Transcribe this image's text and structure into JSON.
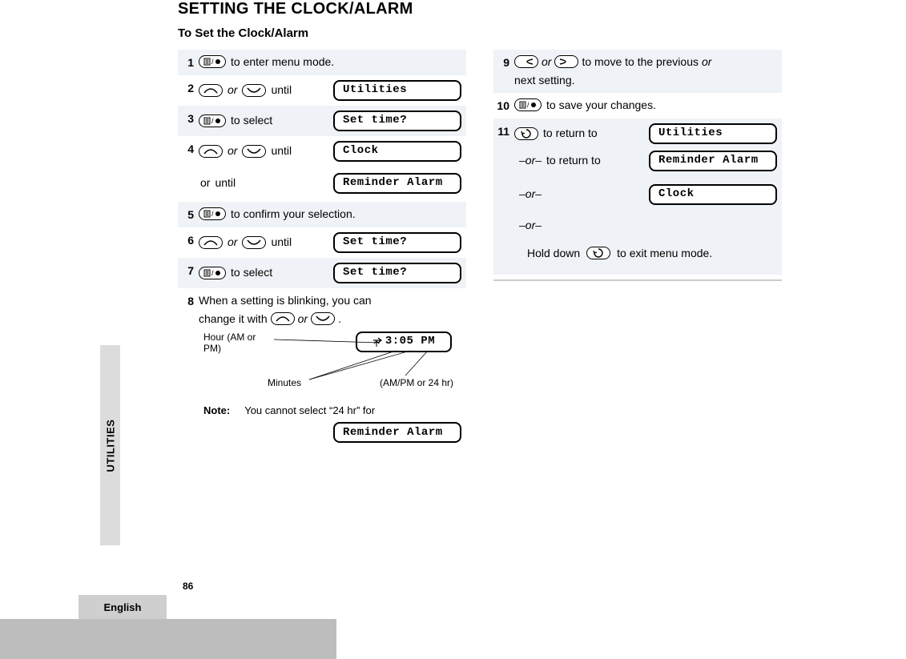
{
  "meta": {
    "side_tab": "UTILITIES",
    "language": "English",
    "page_number": "86"
  },
  "title": "SETTING THE CLOCK/ALARM",
  "subtitle": "To Set the Clock/Alarm",
  "left_steps": {
    "s1": {
      "num": "1",
      "t1": " to enter menu mode."
    },
    "s2": {
      "num": "2",
      "or": "or",
      "t1": " until",
      "lcd": "Utilities"
    },
    "s3": {
      "num": "3",
      "t1": " to select",
      "lcd": "Set time?"
    },
    "s4": {
      "num": "4",
      "or": "or",
      "t1": " until",
      "lcd": "Clock",
      "sub_or": "or",
      "sub_t1": " until",
      "sub_lcd": "Reminder Alarm"
    },
    "s5": {
      "num": "5",
      "t1": " to confirm your selection."
    },
    "s6": {
      "num": "6",
      "or": "or",
      "t1": " until",
      "lcd": "Set time?"
    },
    "s7": {
      "num": "7",
      "t1": " to select",
      "lcd": "Set time?"
    },
    "s8": {
      "num": "8",
      "line1a": "When a setting is blinking, you can",
      "line1b": "change it with ",
      "or": "or",
      "line1c": ".",
      "hour_label": "Hour (AM or PM)",
      "min_label": "Minutes",
      "ampm_label": "(AM/PM or 24 hr)",
      "time_lcd": "3:05 PM",
      "note_label": "Note:",
      "note_text": "You cannot select “24 hr” for",
      "note_lcd": "Reminder Alarm"
    }
  },
  "right_steps": {
    "s9": {
      "num": "9",
      "or": "or",
      "t1": " to move to the previous ",
      "or2": "or",
      "t2": "next setting."
    },
    "s10": {
      "num": "10",
      "t1": " to save your changes."
    },
    "s11": {
      "num": "11",
      "t1": " to return to",
      "lcd1": "Utilities",
      "or1": "–or–",
      "t2": " to return to",
      "lcd2": "Reminder Alarm",
      "or2": "–or–",
      "lcd3": "Clock",
      "or3": "–or–",
      "exit_a": "Hold down ",
      "exit_b": " to exit menu mode."
    }
  }
}
